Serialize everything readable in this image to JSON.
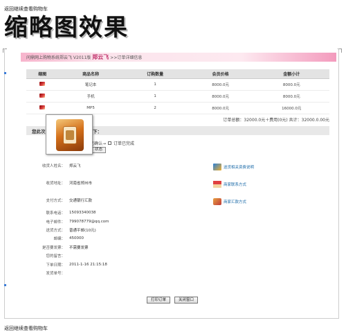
{
  "top_link": "返回继续查看购物车",
  "page_title": "缩略图效果",
  "breadcrumb": {
    "prefix": "问鼎网上购物系统郑云飞 V2011版",
    "highlight": "郑云飞",
    "suffix": ">>订单详细信息"
  },
  "items_table": {
    "headers": [
      "缩图",
      "商品名称",
      "订购数量",
      "会员价格",
      "金额小计"
    ],
    "rows": [
      {
        "name": "笔记本",
        "qty": "1",
        "price": "8000.0元",
        "subtotal": "8000.0元"
      },
      {
        "name": "手机",
        "qty": "1",
        "price": "8000.0元",
        "subtotal": "8000.0元"
      },
      {
        "name": "MP5",
        "qty": "2",
        "price": "8000.0元",
        "subtotal": "16000.0元"
      }
    ]
  },
  "summary": "订单总额：32000.0元＋费用(0元)   共计：32000.0.00元",
  "info_bar": "您此次 [ ...S10 ] 详细信息如下：",
  "status": {
    "steps": [
      "订单已确认→",
      "订单已完成"
    ],
    "button": "状态"
  },
  "form": {
    "fields": [
      {
        "label": "收货人姓名：",
        "value": "郑云飞"
      },
      {
        "label": "收货地址：",
        "value": "河南省郑州市"
      },
      {
        "label": "支付方式：",
        "value": "交通银行汇款"
      },
      {
        "label": "联系电话：",
        "value": "15093340038"
      },
      {
        "label": "电子邮件：",
        "value": "799078779@qq.com"
      },
      {
        "label": "送货方式：",
        "value": "普通平邮(10元)"
      },
      {
        "label": "邮编：",
        "value": "450000"
      },
      {
        "label": "是否要发票：",
        "value": "不需要发票"
      },
      {
        "label": "您的留言：",
        "value": ""
      },
      {
        "label": "下单日期：",
        "value": "2011-1-16 21:15:18"
      },
      {
        "label": "发货单号：",
        "value": ""
      }
    ]
  },
  "side_links": [
    {
      "label": "送货相关资费说明",
      "icon": "truck-icon"
    },
    {
      "label": "商家联系方式",
      "icon": "house-icon"
    },
    {
      "label": "商家汇款方式",
      "icon": "card-icon"
    }
  ],
  "buttons": {
    "print": "打印订单",
    "close": "关闭窗口"
  },
  "bottom_link": "返回继续查看购物车",
  "colors": {
    "accent_pink": "#f39bbd",
    "highlight_text": "#c0306a",
    "link_blue": "#1a6aa8"
  }
}
